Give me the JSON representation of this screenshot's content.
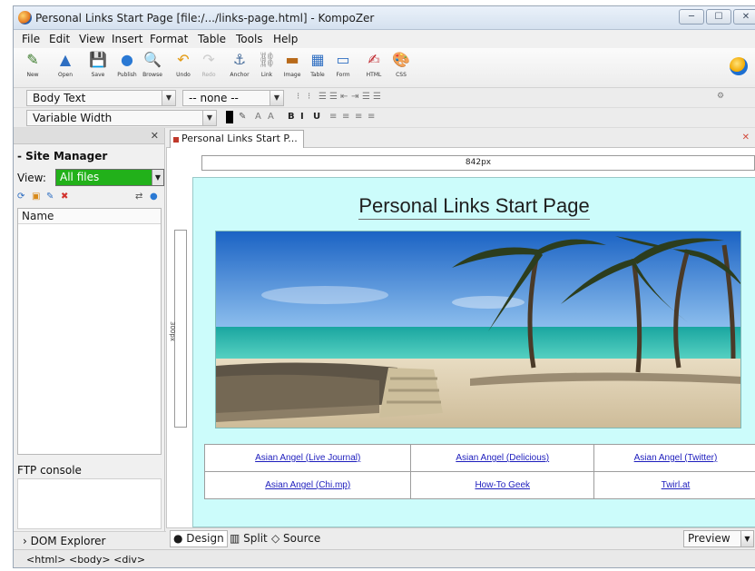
{
  "window": {
    "title": "Personal Links Start Page [file:/.../links-page.html] - KompoZer",
    "minimize": "─",
    "maximize": "☐",
    "close": "✕"
  },
  "menu": [
    "File",
    "Edit",
    "View",
    "Insert",
    "Format",
    "Table",
    "Tools",
    "Help"
  ],
  "toolbar": {
    "buttons": [
      {
        "label": "New",
        "icon": "pencil-icon",
        "glyph": "✎",
        "color": "#3a7a2a",
        "enabled": true
      },
      {
        "label": "Open",
        "icon": "open-icon",
        "glyph": "▲",
        "color": "#2f6fc2",
        "enabled": true
      },
      {
        "label": "Save",
        "icon": "save-icon",
        "glyph": "💾",
        "color": "#2d4f8e",
        "enabled": true
      },
      {
        "label": "Publish",
        "icon": "publish-icon",
        "glyph": "●",
        "color": "#2a79d4",
        "enabled": true
      },
      {
        "label": "Browse",
        "icon": "browse-icon",
        "glyph": "🔍",
        "color": "#5a5a5a",
        "enabled": true
      },
      {
        "label": "Undo",
        "icon": "undo-icon",
        "glyph": "↶",
        "color": "#e39a12",
        "enabled": true
      },
      {
        "label": "Redo",
        "icon": "redo-icon",
        "glyph": "↷",
        "color": "#9a9a9a",
        "enabled": false
      },
      {
        "label": "Anchor",
        "icon": "anchor-icon",
        "glyph": "⚓",
        "color": "#4a6f9c",
        "enabled": true
      },
      {
        "label": "Link",
        "icon": "link-icon",
        "glyph": "⛓",
        "color": "#8c8c8c",
        "enabled": true
      },
      {
        "label": "Image",
        "icon": "image-icon",
        "glyph": "▬",
        "color": "#b86a1a",
        "enabled": true
      },
      {
        "label": "Table",
        "icon": "table-icon",
        "glyph": "▦",
        "color": "#2f6fc2",
        "enabled": true
      },
      {
        "label": "Form",
        "icon": "form-icon",
        "glyph": "▭",
        "color": "#2f6fc2",
        "enabled": true
      },
      {
        "label": "HTML",
        "icon": "html-icon",
        "glyph": "✍",
        "color": "#c0272d",
        "enabled": true
      },
      {
        "label": "CSS",
        "icon": "css-icon",
        "glyph": "🎨",
        "color": "#d4862a",
        "enabled": true
      }
    ]
  },
  "format": {
    "paragraph_style": "Body Text",
    "class_style": "-- none --",
    "font": "Variable Width",
    "bar1_icons": [
      "⁝",
      "⁝",
      "☰",
      "☰",
      "⇤",
      "⇥",
      "☰",
      "☰"
    ],
    "bar2_icons": [
      "A",
      "A",
      "B",
      "I",
      "U",
      "≡",
      "≡",
      "≡",
      "≡"
    ]
  },
  "sidebar": {
    "close": "✕",
    "site_manager": "- Site Manager",
    "view_label": "View:",
    "view_value": "All files",
    "name_column": "Name",
    "ftp_console": "FTP console",
    "dom_explorer": "› DOM Explorer"
  },
  "tab": {
    "label": "Personal Links Start P...",
    "close": "✕"
  },
  "editor": {
    "width_ruler": "842px",
    "height_ruler": "300px",
    "page_title": "Personal Links Start Page",
    "links": [
      [
        "Asian Angel (Live Journal)",
        "Asian Angel (Delicious)",
        "Asian Angel (Twitter)"
      ],
      [
        "Asian Angel (Chi.mp)",
        "How-To Geek",
        "Twirl.at"
      ]
    ]
  },
  "view_tabs": {
    "design": "● Design",
    "split": "▥ Split",
    "source": "◇ Source",
    "preview": "Preview"
  },
  "status": {
    "tag_path": "<html> <body> <div>"
  },
  "colors": {
    "page_bg": "#ccfcfb",
    "view_select": "#22b11a",
    "link": "#1d1dbd"
  }
}
